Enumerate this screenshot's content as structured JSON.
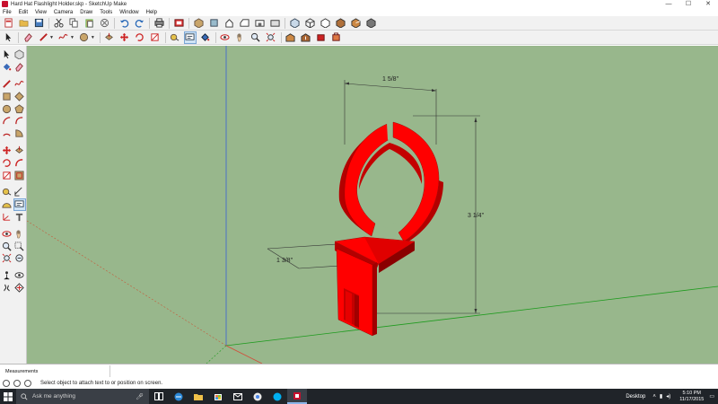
{
  "window": {
    "title": "Hard Hat Flashlight Holder.skp - SketchUp Make",
    "minimize": "—",
    "maximize": "☐",
    "close": "✕"
  },
  "menu": [
    "File",
    "Edit",
    "View",
    "Camera",
    "Draw",
    "Tools",
    "Window",
    "Help"
  ],
  "viewport": {
    "background": "#98b78c",
    "model_color": "#ff0000",
    "dimensions": {
      "width_top": "1 5/8\"",
      "height_right": "3 1/4\"",
      "depth_left": "1 3/8\""
    }
  },
  "measurements": {
    "label": "Measurements"
  },
  "status": {
    "message": "Select object to attach text to or position on screen."
  },
  "taskbar": {
    "search_placeholder": "Ask me anything",
    "desktop_label": "Desktop",
    "time": "5:10 PM",
    "date": "11/17/2015"
  }
}
